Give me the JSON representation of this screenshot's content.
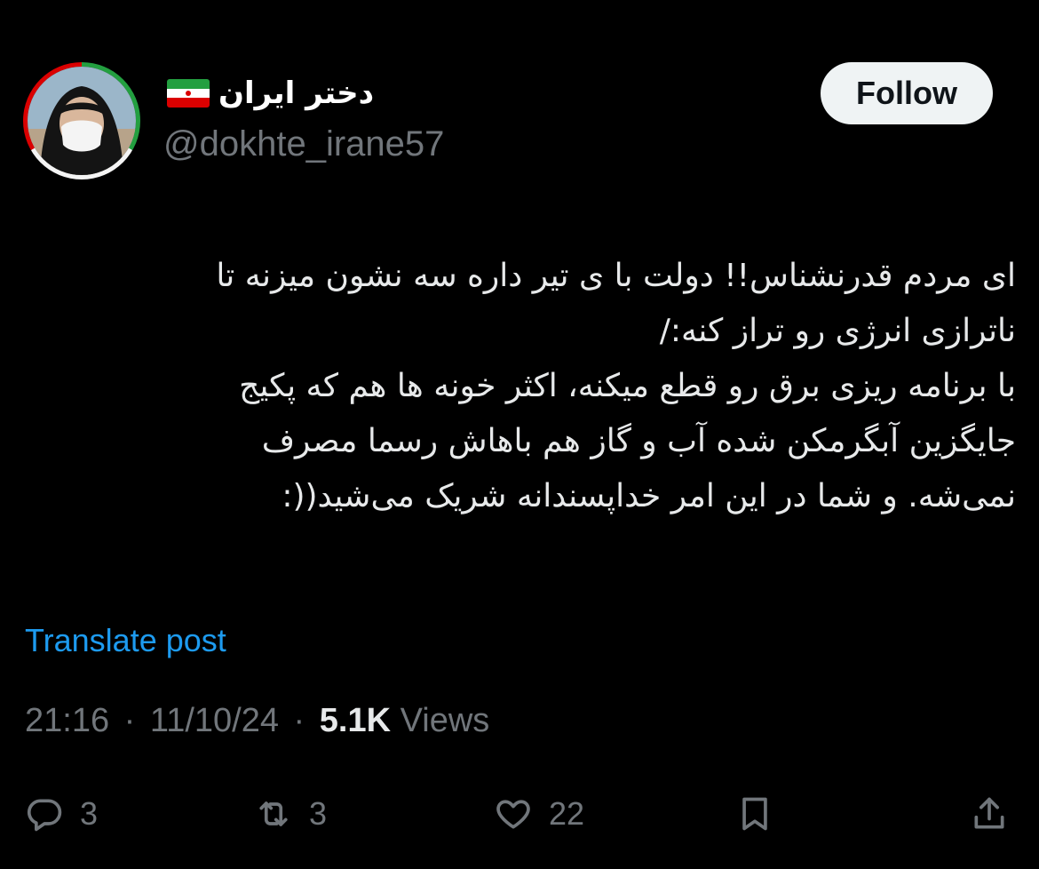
{
  "author": {
    "display_name": "دختر ایران",
    "handle": "@dokhte_irane57",
    "flag_icon": "iran-flag-icon",
    "avatar_icon": "masked-person-avatar"
  },
  "follow_label": "Follow",
  "tweet": {
    "lines": [
      "ای مردم قدرنشناس!! دولت با ی تیر داره سه نشون میزنه تا",
      "ناترازی انرژی رو تراز کنه:/",
      "با برنامه ریزی برق رو قطع میکنه، اکثر خونه ها هم که پکیج",
      "جایگزین آبگرمکن شده آب و گاز هم باهاش رسما مصرف",
      "نمی‌شه. و شما در این امر خداپسندانه شریک می‌شید((:"
    ]
  },
  "translate_label": "Translate post",
  "meta": {
    "time": "21:16",
    "separator": "·",
    "date": "11/10/24",
    "views_count": "5.1K",
    "views_label": "Views"
  },
  "actions": {
    "reply_count": "3",
    "repost_count": "3",
    "like_count": "22"
  },
  "colors": {
    "background": "#000000",
    "text": "#e7e9ea",
    "muted": "#71767b",
    "link": "#1d9bf0",
    "follow_bg": "#eff3f4"
  }
}
